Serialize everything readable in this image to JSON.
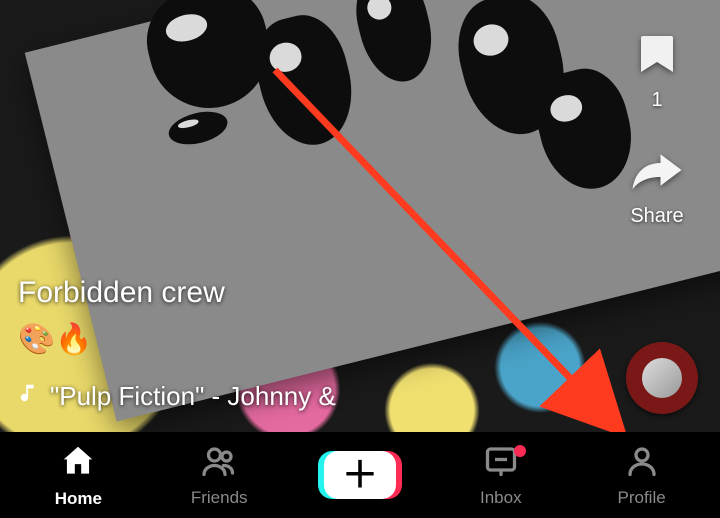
{
  "caption": "Forbidden crew",
  "caption_emoji": "🎨🔥",
  "music": {
    "label": "\"Pulp Fiction\" - Johnny &"
  },
  "rail": {
    "bookmark_count": "1",
    "share_label": "Share"
  },
  "nav": {
    "home": "Home",
    "friends": "Friends",
    "inbox": "Inbox",
    "profile": "Profile"
  },
  "colors": {
    "accent_cyan": "#25F4EE",
    "accent_red": "#FE2C55",
    "annotation": "#FF3B1F"
  }
}
